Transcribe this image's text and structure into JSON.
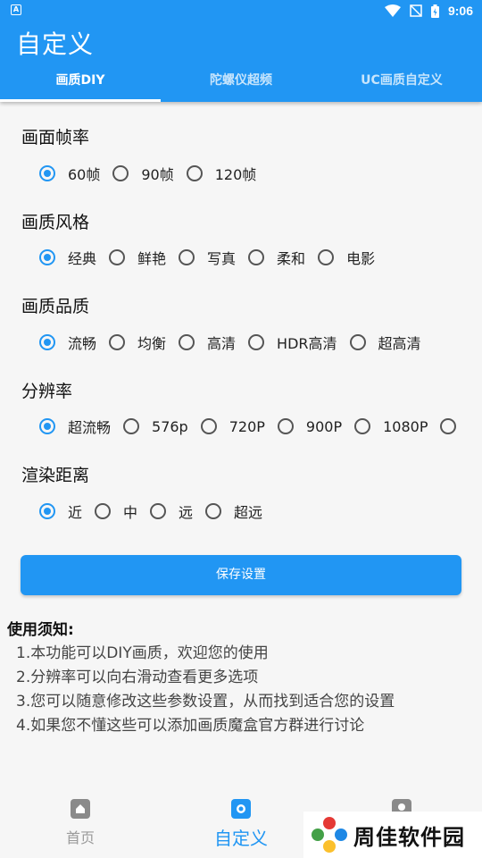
{
  "status": {
    "time": "9:06",
    "left_glyph": "A"
  },
  "app": {
    "title": "自定义"
  },
  "tabs": [
    {
      "label": "画质DIY",
      "active": true
    },
    {
      "label": "陀螺仪超频",
      "active": false
    },
    {
      "label": "UC画质自定义",
      "active": false
    }
  ],
  "groups": {
    "framerate": {
      "title": "画面帧率",
      "options": [
        "60帧",
        "90帧",
        "120帧"
      ],
      "selected": "60帧"
    },
    "style": {
      "title": "画质风格",
      "options": [
        "经典",
        "鲜艳",
        "写真",
        "柔和",
        "电影"
      ],
      "selected": "经典"
    },
    "quality": {
      "title": "画质品质",
      "options": [
        "流畅",
        "均衡",
        "高清",
        "HDR高清",
        "超高清"
      ],
      "selected": "流畅"
    },
    "resolution": {
      "title": "分辨率",
      "options": [
        "超流畅",
        "576p",
        "720P",
        "900P",
        "1080P",
        ""
      ],
      "selected": "超流畅"
    },
    "distance": {
      "title": "渲染距离",
      "options": [
        "近",
        "中",
        "远",
        "超远"
      ],
      "selected": "近"
    }
  },
  "save_button": {
    "label": "保存设置"
  },
  "notice": {
    "title": "使用须知:",
    "items": [
      "1.本功能可以DIY画质，欢迎您的使用",
      "2.分辨率可以向右滑动查看更多选项",
      "3.您可以随意修改这些参数设置，从而找到适合您的设置",
      "4.如果您不懂这些可以添加画质魔盒官方群进行讨论"
    ]
  },
  "bottom_nav": [
    {
      "label": "首页",
      "icon": "home-icon",
      "active": false
    },
    {
      "label": "自定义",
      "icon": "custom-icon",
      "active": true
    },
    {
      "label": "",
      "icon": "profile-icon",
      "active": false
    }
  ],
  "watermark": {
    "text": "周佳软件园"
  },
  "colors": {
    "primary": "#2196f3",
    "background": "#f6f6f6"
  }
}
